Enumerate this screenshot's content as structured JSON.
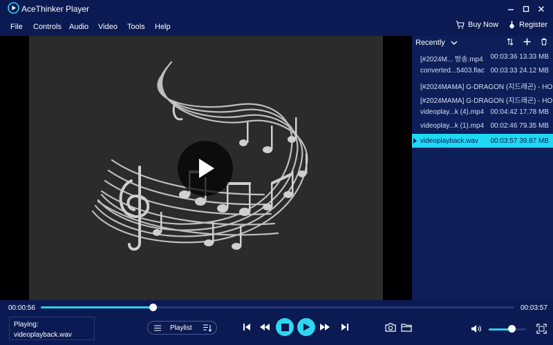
{
  "window": {
    "title": "AceThinker Player"
  },
  "menu": {
    "items": [
      "File",
      "Controls",
      "Audio",
      "Video",
      "Tools",
      "Help"
    ],
    "buy_now": "Buy Now",
    "register": "Register"
  },
  "playlist": {
    "sort_label": "Recently",
    "items": [
      {
        "name": "[#2024M... 방송.mp4",
        "duration": "00:03:36",
        "size": "13.33 MB",
        "active": false
      },
      {
        "name": "converted...5403.flac",
        "duration": "00:03:33",
        "size": "24.12 MB",
        "active": false
      },
      {
        "name": "[#2024MAMA] G-DRAGON (지드래곤) - HO...",
        "duration": "",
        "size": "",
        "active": false
      },
      {
        "name": "[#2024MAMA] G-DRAGON (지드래곤) - HO...",
        "duration": "",
        "size": "",
        "active": false
      },
      {
        "name": "videoplay...k (4).mp4",
        "duration": "00:04:42",
        "size": "17.78 MB",
        "active": false
      },
      {
        "name": "videoplay...k (1).mp4",
        "duration": "00:02:46",
        "size": "79.35 MB",
        "active": false
      },
      {
        "name": "videoplayback.wav",
        "duration": "00:03:57",
        "size": "39.87 MB",
        "active": true
      }
    ]
  },
  "playback": {
    "current_time": "00:00:56",
    "total_time": "00:03:57",
    "progress_fraction": 0.236,
    "volume_fraction": 0.7
  },
  "now_playing": {
    "label": "Playing:",
    "file": "videoplayback.wav"
  },
  "controls": {
    "playlist_label": "Playlist"
  },
  "colors": {
    "background": "#0b1a52",
    "accent": "#2fd6f0",
    "active_row": "#1fd9f2"
  }
}
